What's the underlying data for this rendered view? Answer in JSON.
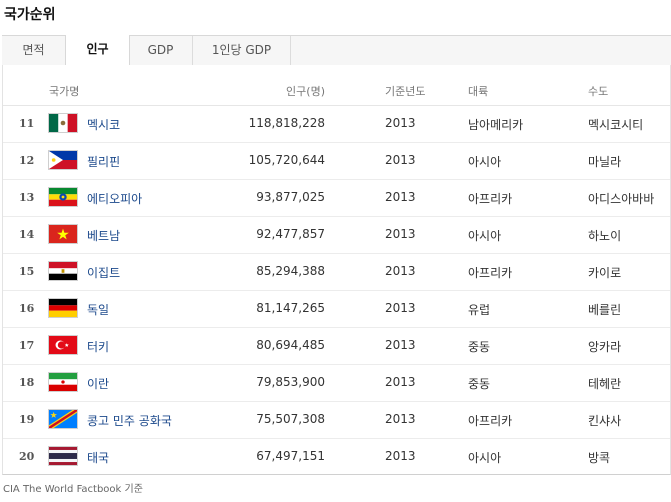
{
  "page_title": "국가순위",
  "tabs": [
    {
      "label": "면적",
      "active": false
    },
    {
      "label": "인구",
      "active": true
    },
    {
      "label": "GDP",
      "active": false
    },
    {
      "label": "1인당 GDP",
      "active": false
    }
  ],
  "columns": {
    "country": "국가명",
    "population": "인구(명)",
    "year": "기준년도",
    "continent": "대륙",
    "capital": "수도"
  },
  "rows": [
    {
      "rank": "11",
      "flag": "mexico-flag-icon",
      "country": "멕시코",
      "population": "118,818,228",
      "year": "2013",
      "continent": "남아메리카",
      "capital": "멕시코시티"
    },
    {
      "rank": "12",
      "flag": "philippines-flag-icon",
      "country": "필리핀",
      "population": "105,720,644",
      "year": "2013",
      "continent": "아시아",
      "capital": "마닐라"
    },
    {
      "rank": "13",
      "flag": "ethiopia-flag-icon",
      "country": "에티오피아",
      "population": "93,877,025",
      "year": "2013",
      "continent": "아프리카",
      "capital": "아디스아바바"
    },
    {
      "rank": "14",
      "flag": "vietnam-flag-icon",
      "country": "베트남",
      "population": "92,477,857",
      "year": "2013",
      "continent": "아시아",
      "capital": "하노이"
    },
    {
      "rank": "15",
      "flag": "egypt-flag-icon",
      "country": "이집트",
      "population": "85,294,388",
      "year": "2013",
      "continent": "아프리카",
      "capital": "카이로"
    },
    {
      "rank": "16",
      "flag": "germany-flag-icon",
      "country": "독일",
      "population": "81,147,265",
      "year": "2013",
      "continent": "유럽",
      "capital": "베를린"
    },
    {
      "rank": "17",
      "flag": "turkey-flag-icon",
      "country": "터키",
      "population": "80,694,485",
      "year": "2013",
      "continent": "중동",
      "capital": "앙카라"
    },
    {
      "rank": "18",
      "flag": "iran-flag-icon",
      "country": "이란",
      "population": "79,853,900",
      "year": "2013",
      "continent": "중동",
      "capital": "테헤란"
    },
    {
      "rank": "19",
      "flag": "dr-congo-flag-icon",
      "country": "콩고 민주 공화국",
      "population": "75,507,308",
      "year": "2013",
      "continent": "아프리카",
      "capital": "킨샤사"
    },
    {
      "rank": "20",
      "flag": "thailand-flag-icon",
      "country": "태국",
      "population": "67,497,151",
      "year": "2013",
      "continent": "아시아",
      "capital": "방콕"
    }
  ],
  "source_note": "CIA The World Factbook 기준"
}
